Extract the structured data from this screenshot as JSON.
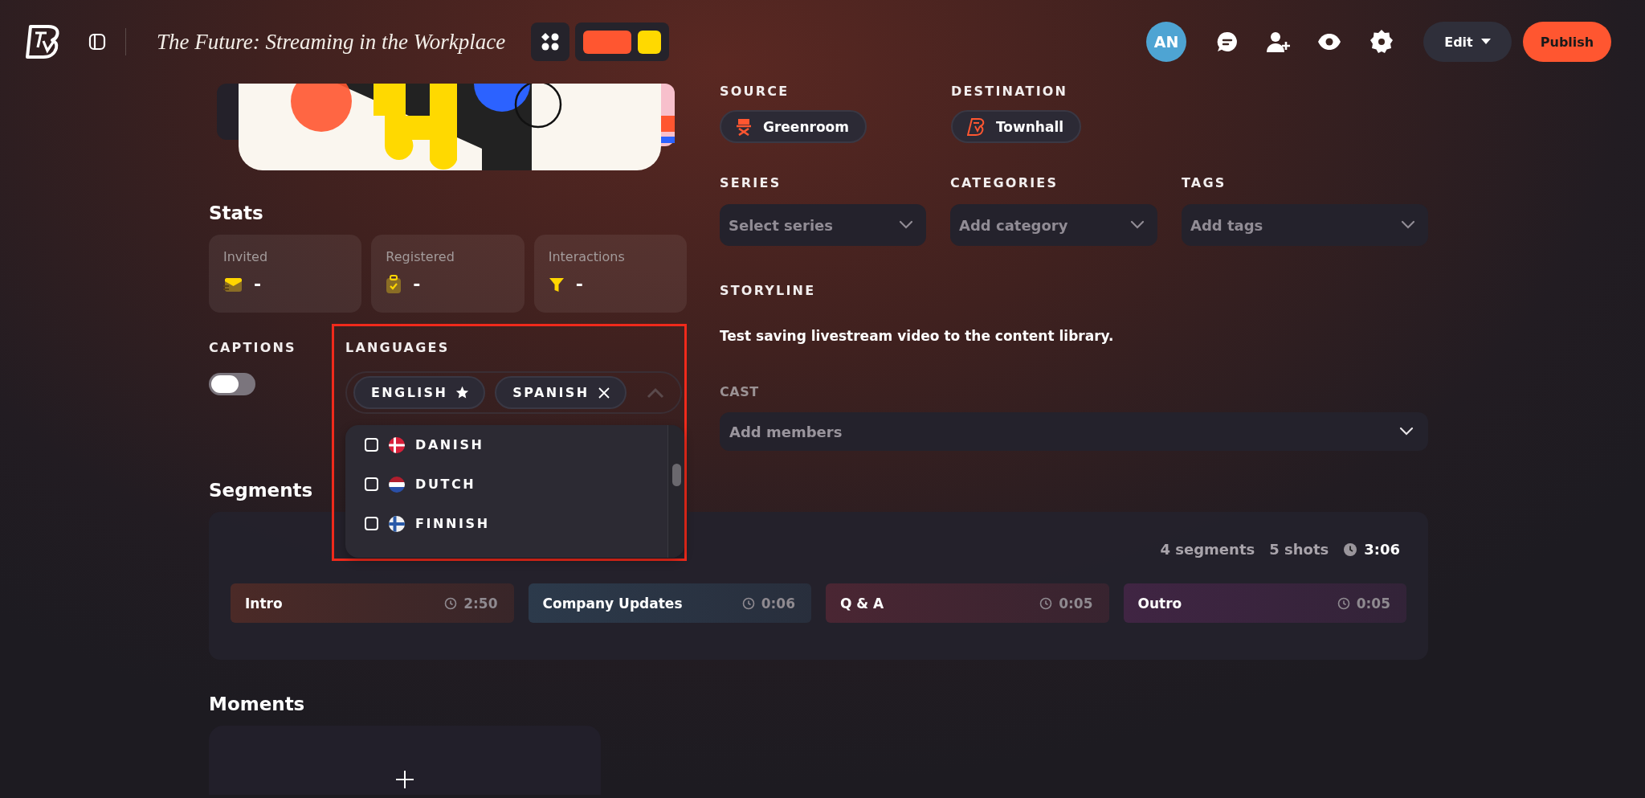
{
  "header": {
    "title": "The Future: Streaming in the Workplace",
    "swatches": [
      {
        "color": "#ff5630"
      },
      {
        "color": "#ffd900"
      }
    ],
    "avatar": "AN",
    "edit_button": "Edit",
    "publish_button": "Publish"
  },
  "stats": {
    "heading": "Stats",
    "cards": [
      {
        "label": "Invited",
        "value": "-",
        "kind": "envelope"
      },
      {
        "label": "Registered",
        "value": "-",
        "kind": "clipboard"
      },
      {
        "label": "Interactions",
        "value": "-",
        "kind": "funnel"
      }
    ]
  },
  "captions": {
    "label": "CAPTIONS",
    "on": false
  },
  "languages": {
    "label": "LANGUAGES",
    "expanded": true,
    "chips": [
      {
        "label": "ENGLISH",
        "kind": "primary"
      },
      {
        "label": "SPANISH",
        "kind": "removable"
      }
    ],
    "options": [
      {
        "label": "DANISH",
        "checked": false,
        "kind": "denmark"
      },
      {
        "label": "DUTCH",
        "checked": false,
        "kind": "netherlands"
      },
      {
        "label": "FINNISH",
        "checked": false,
        "kind": "finland"
      }
    ]
  },
  "source": {
    "label": "SOURCE",
    "value": "Greenroom"
  },
  "destination": {
    "label": "DESTINATION",
    "value": "Townhall"
  },
  "selects": [
    {
      "label": "SERIES",
      "placeholder": "Select series"
    },
    {
      "label": "CATEGORIES",
      "placeholder": "Add category"
    },
    {
      "label": "TAGS",
      "placeholder": "Add tags"
    }
  ],
  "storyline": {
    "label": "STORYLINE",
    "text": "Test saving livestream video to the content library."
  },
  "cast": {
    "label": "CAST",
    "placeholder": "Add members"
  },
  "segments": {
    "heading": "Segments",
    "count": "4 segments",
    "shots": "5 shots",
    "duration": "3:06",
    "items": [
      {
        "name": "Intro",
        "duration": "2:50",
        "color": "#4b2a27"
      },
      {
        "name": "Company Updates",
        "duration": "0:06",
        "color": "#2c3a4b"
      },
      {
        "name": "Q & A",
        "duration": "0:05",
        "color": "#4a2633"
      },
      {
        "name": "Outro",
        "duration": "0:05",
        "color": "#402543"
      }
    ]
  },
  "moments": {
    "heading": "Moments"
  }
}
